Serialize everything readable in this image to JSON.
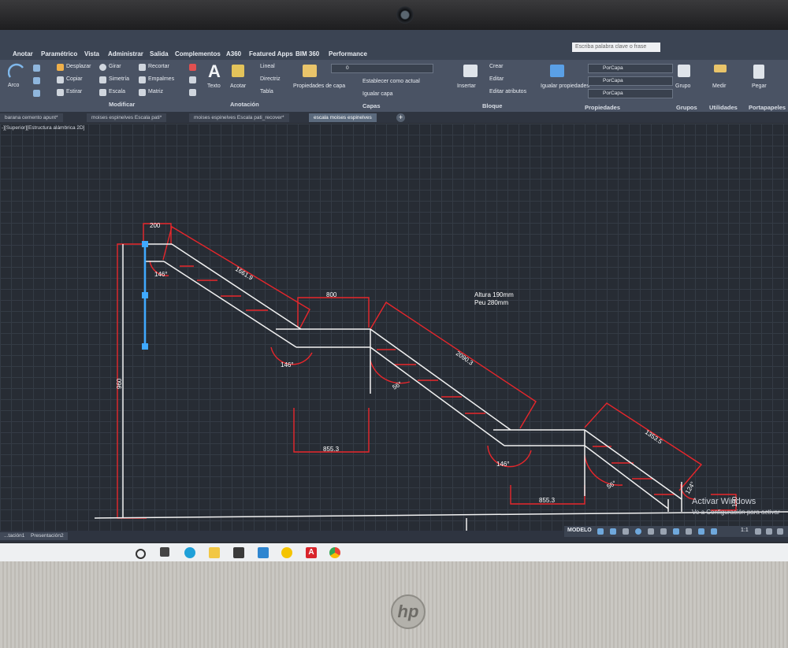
{
  "window": {
    "search_placeholder": "Escriba palabra clave o frase"
  },
  "ribbon": {
    "tabs": [
      "Anotar",
      "Paramétrico",
      "Vista",
      "Administrar",
      "Salida",
      "Complementos",
      "A360",
      "Featured Apps",
      "BIM 360",
      "Performance"
    ],
    "groups": {
      "dibujo_label": "Arco",
      "modificar_label": "Modificar",
      "modificar_items": [
        "Desplazar",
        "Girar",
        "Recortar",
        "Copiar",
        "Simetría",
        "Empalmes",
        "Estirar",
        "Escala",
        "Matriz"
      ],
      "anotacion_label": "Anotación",
      "anotacion_items": [
        "Texto",
        "Acotar",
        "Lineal",
        "Directriz",
        "Tabla"
      ],
      "capas_label": "Capas",
      "capas_items": [
        "Propiedades de capa",
        "Establecer como actual",
        "Igualar capa"
      ],
      "bloque_label": "Bloque",
      "bloque_items": [
        "Insertar",
        "Crear",
        "Editar",
        "Editar atributos"
      ],
      "propiedades_label": "Propiedades",
      "propiedades_items": [
        "Igualar propiedades",
        "PorCapa",
        "PorCapa",
        "PorCapa"
      ],
      "grupos_label": "Grupos",
      "grupo_item": "Grupo",
      "utilidades_label": "Utilidades",
      "medir_item": "Medir",
      "portapapeles_label": "Portapapeles",
      "pegar_item": "Pegar"
    },
    "layer_value": "0"
  },
  "document_tabs": [
    {
      "label": "barana cemento apunt*",
      "active": false
    },
    {
      "label": "moises espinelves Escala pati*",
      "active": false
    },
    {
      "label": "moises espinelves Escala pati_recover*",
      "active": false
    },
    {
      "label": "escala moises espinelves",
      "active": true
    }
  ],
  "viewport_label": "-][Superior][Estructura alámbrica 2D]",
  "drawing": {
    "dimensions": {
      "top_width": "200",
      "flight1_length": "1661.9",
      "landing1_width": "800",
      "flight2_length": "2090.3",
      "flight3_length": "1353.5",
      "angle_146_a": "146°",
      "angle_146_b": "146°",
      "angle_146_c": "146°",
      "angle_56_a": "56°",
      "angle_56_b": "56°",
      "angle_124": "124°",
      "base_855_a": "855.3",
      "base_855_b": "855.3",
      "height_total": "960",
      "height_small": "190"
    },
    "note_line1": "Altura 190mm",
    "note_line2": "Peu 280mm",
    "colors": {
      "dimension_red": "#e8262b",
      "geometry_white": "#f2f2f2",
      "selection_blue": "#3fa9ff"
    }
  },
  "windows_activation": {
    "title": "Activar Windows",
    "subtitle": "Ve a Configuración para activar"
  },
  "layout_tabs": [
    "...tación1",
    "Presentación2"
  ],
  "status": {
    "model_label": "MODELO",
    "scale": "1:1"
  },
  "taskbar": {
    "icons": [
      "cortana-icon",
      "task-view-icon",
      "edge-icon",
      "file-explorer-icon",
      "store-icon",
      "mail-icon",
      "norton-icon",
      "autocad-icon",
      "chrome-icon"
    ]
  }
}
